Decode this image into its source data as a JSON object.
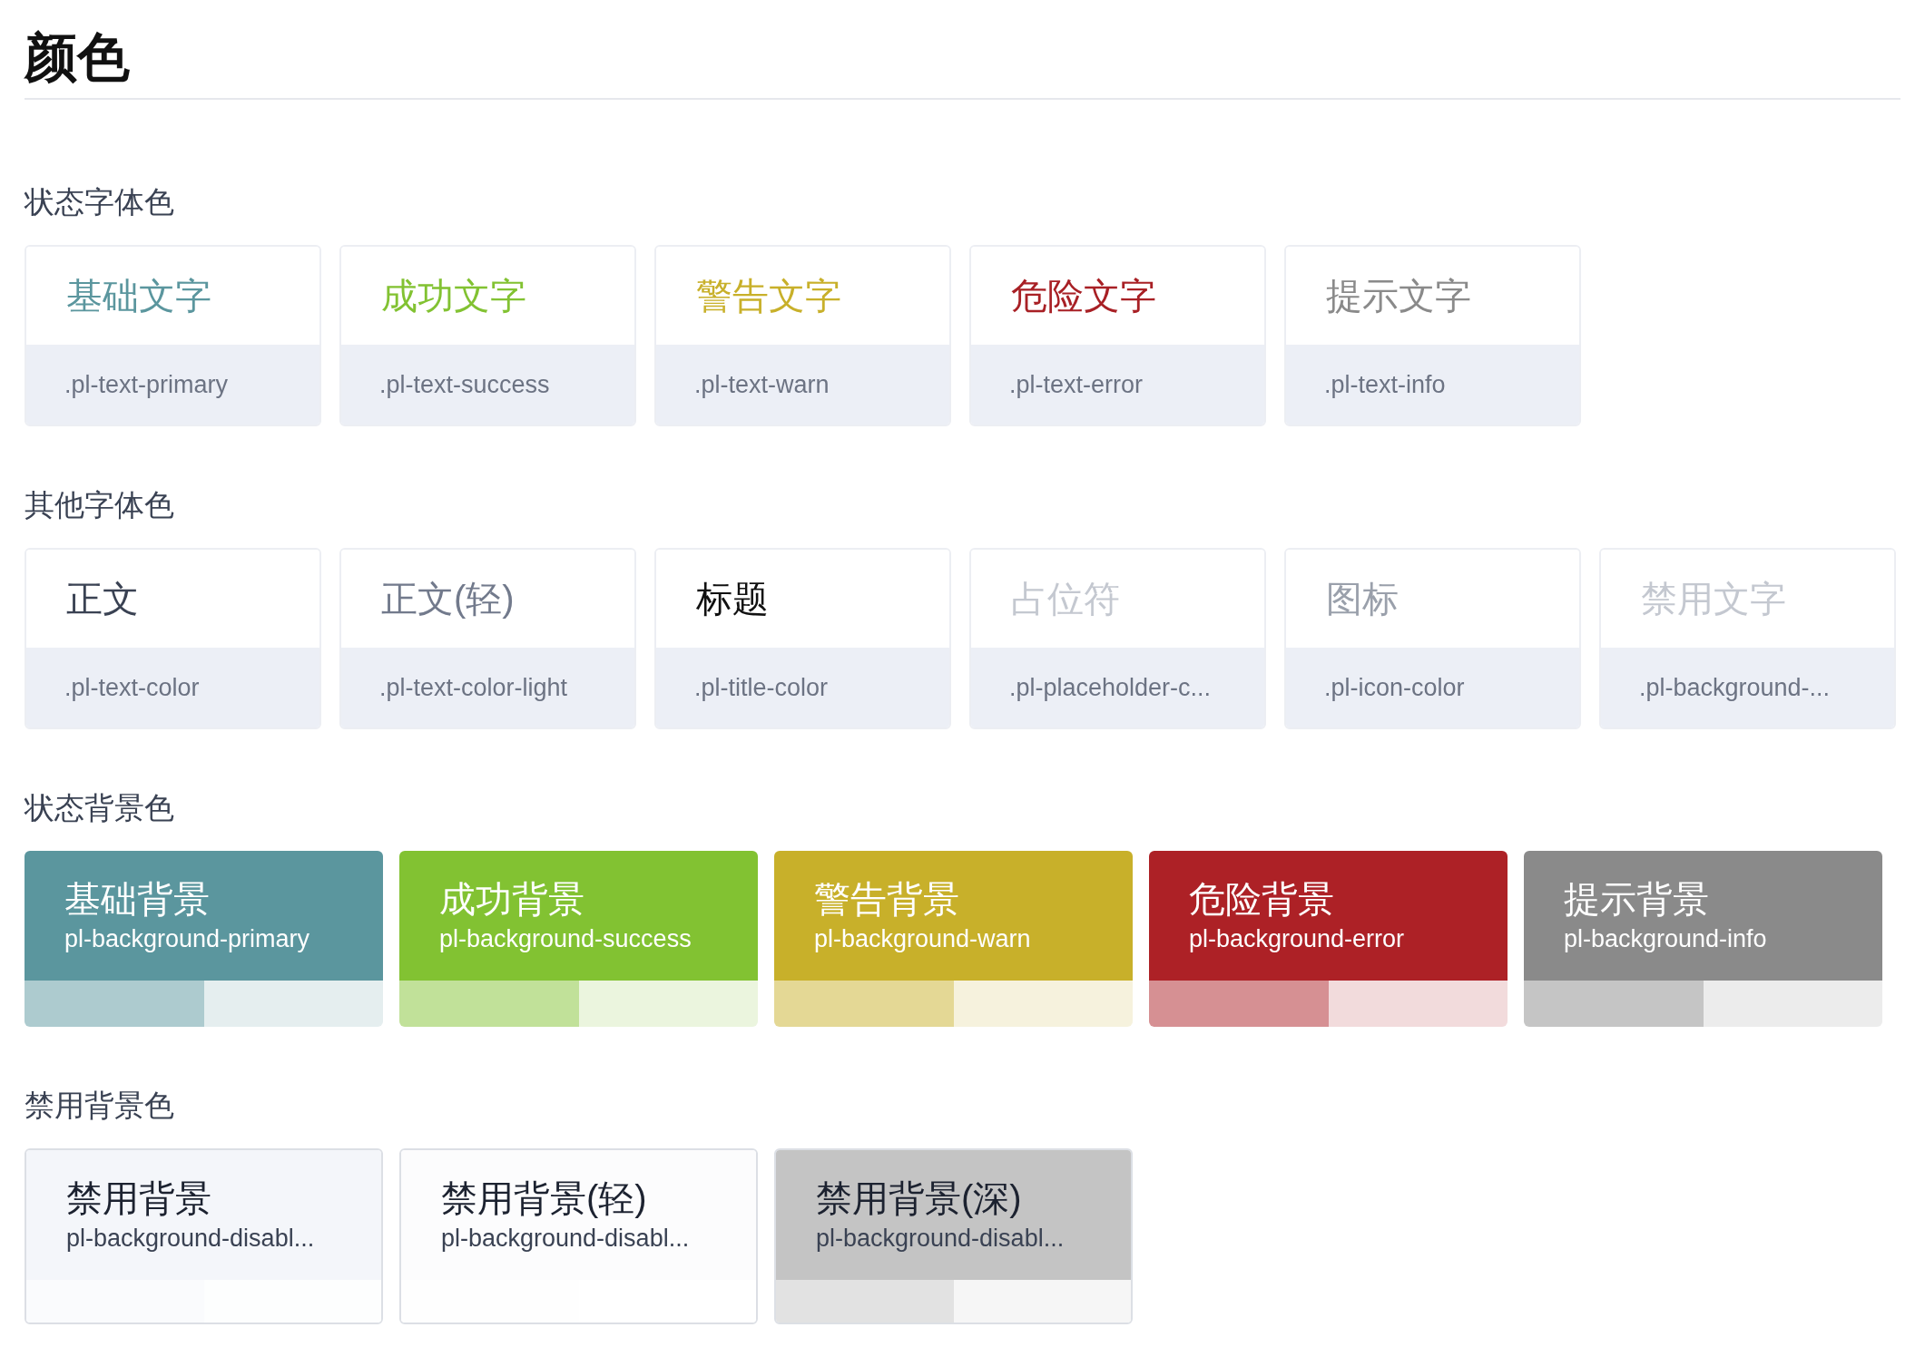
{
  "title": "颜色",
  "sections": [
    {
      "kind": "text",
      "label": "状态字体色",
      "items": [
        {
          "sample": "基础文字",
          "code": ".pl-text-primary",
          "color": "#5b969e"
        },
        {
          "sample": "成功文字",
          "code": ".pl-text-success",
          "color": "#82c232"
        },
        {
          "sample": "警告文字",
          "code": ".pl-text-warn",
          "color": "#c8b02a"
        },
        {
          "sample": "危险文字",
          "code": ".pl-text-error",
          "color": "#a82025"
        },
        {
          "sample": "提示文字",
          "code": ".pl-text-info",
          "color": "#8a8a8a"
        }
      ]
    },
    {
      "kind": "text",
      "label": "其他字体色",
      "items": [
        {
          "sample": "正文",
          "code": ".pl-text-color",
          "color": "#3a4253"
        },
        {
          "sample": "正文(轻)",
          "code": ".pl-text-color-light",
          "color": "#727a8c"
        },
        {
          "sample": "标题",
          "code": ".pl-title-color",
          "color": "#111111"
        },
        {
          "sample": "占位符",
          "code": ".pl-placeholder-c...",
          "color": "#c4c8d0"
        },
        {
          "sample": "图标",
          "code": ".pl-icon-color",
          "color": "#9aa0ab"
        },
        {
          "sample": "禁用文字",
          "code": ".pl-background-...",
          "color": "#c4c8d0"
        }
      ]
    },
    {
      "kind": "status-background",
      "label": "状态背景色",
      "items": [
        {
          "sample": "基础背景",
          "code": "pl-background-primary",
          "color": "#5b969e"
        },
        {
          "sample": "成功背景",
          "code": "pl-background-success",
          "color": "#82c232"
        },
        {
          "sample": "警告背景",
          "code": "pl-background-warn",
          "color": "#c8b02a"
        },
        {
          "sample": "危险背景",
          "code": "pl-background-error",
          "color": "#ad2126"
        },
        {
          "sample": "提示背景",
          "code": "pl-background-info",
          "color": "#8a8a8a"
        }
      ]
    },
    {
      "kind": "disabled-background",
      "label": "禁用背景色",
      "items": [
        {
          "sample": "禁用背景",
          "code": "pl-background-disabl...",
          "color": "#f4f6fa"
        },
        {
          "sample": "禁用背景(轻)",
          "code": "pl-background-disabl...",
          "color": "#fcfcfd"
        },
        {
          "sample": "禁用背景(深)",
          "code": "pl-background-disabl...",
          "color": "#c4c4c4"
        }
      ]
    }
  ]
}
